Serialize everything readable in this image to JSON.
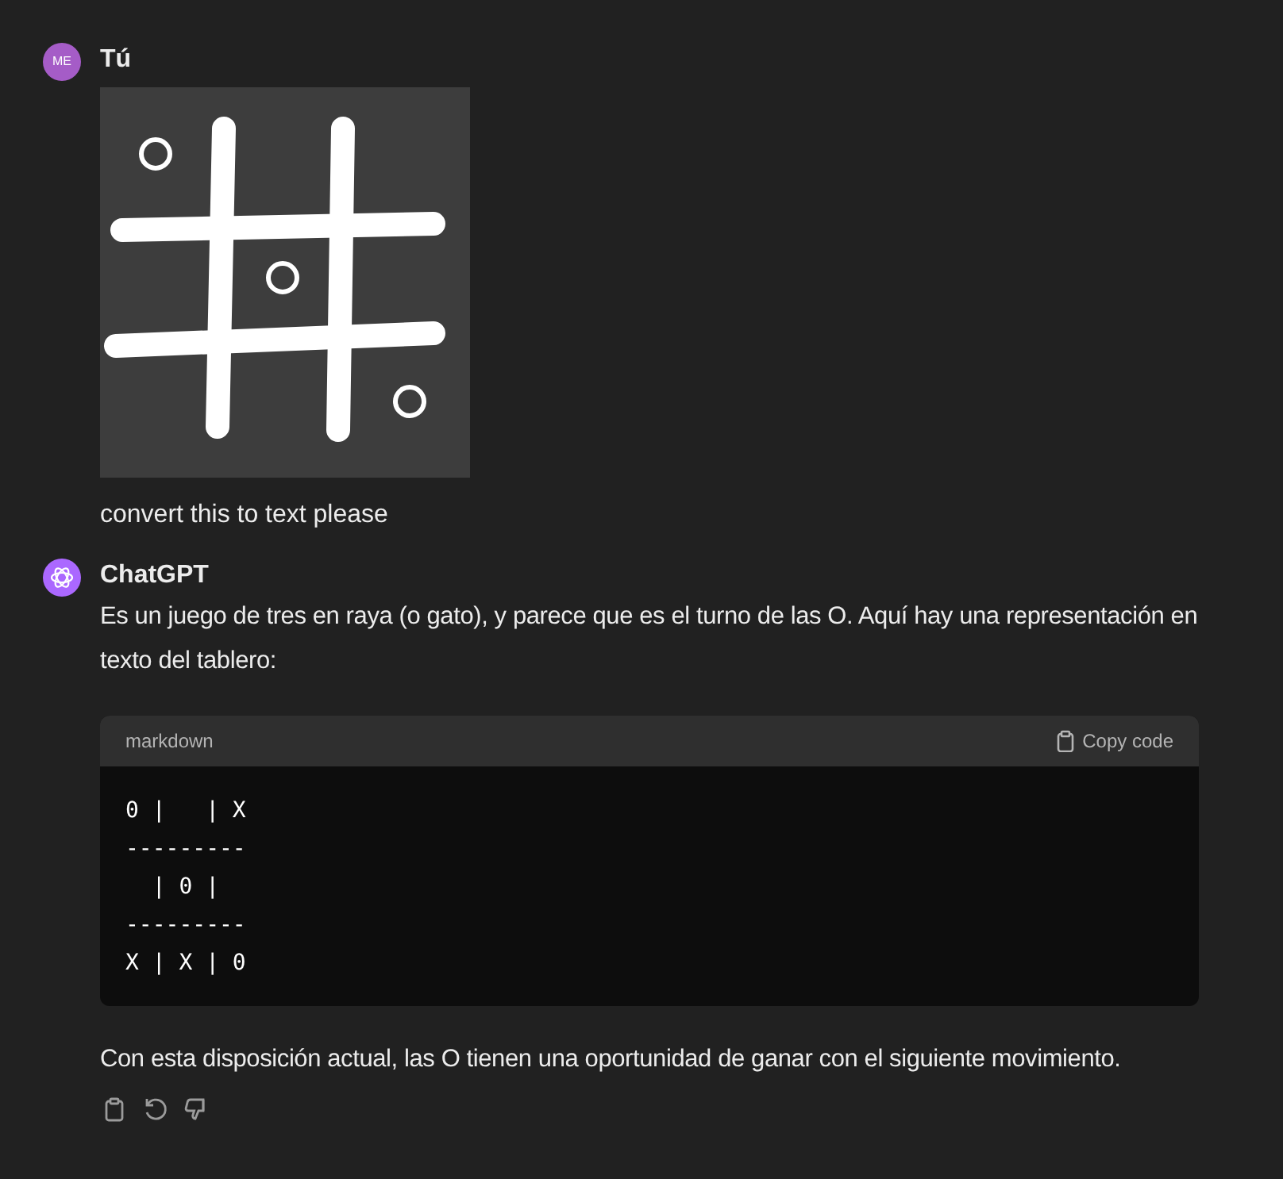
{
  "messages": [
    {
      "kind": "user",
      "avatar": "ME",
      "author": "Tú",
      "text": "convert this to text please"
    },
    {
      "kind": "assistant",
      "author": "ChatGPT",
      "text": "Es un juego de tres en raya (o gato), y parece que es el turno de las O. Aquí hay una representación en texto del tablero:",
      "code": {
        "language": "markdown",
        "copy_label": "Copy code",
        "lines": [
          "0 |   | X",
          "---------",
          "  | 0 |",
          "---------",
          "X | X | 0"
        ]
      },
      "after": "Con esta disposición actual, las O tienen una oportunidad de ganar con el siguiente movimiento."
    }
  ]
}
